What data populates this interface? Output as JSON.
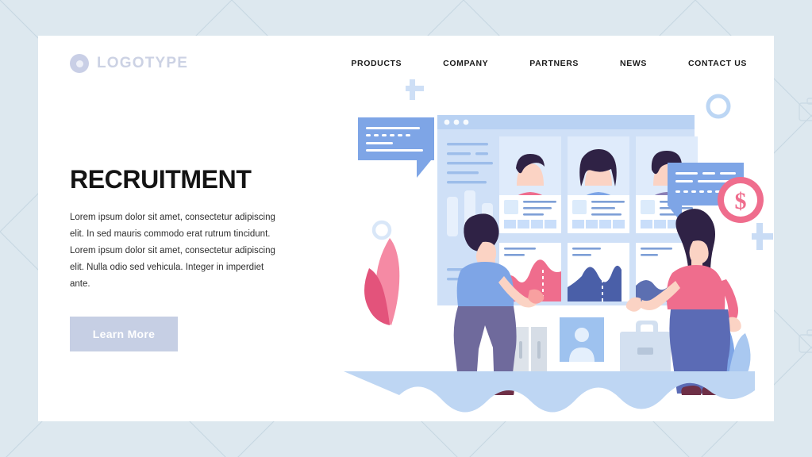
{
  "page": {
    "background_color": "#dde8ef",
    "card_color": "#ffffff"
  },
  "header": {
    "brand": {
      "label": "LOGOTYPE",
      "icon": "ring-logo-icon",
      "color": "#ccd2e4"
    },
    "nav": [
      {
        "label": "PRODUCTS"
      },
      {
        "label": "COMPANY"
      },
      {
        "label": "PARTNERS"
      },
      {
        "label": "NEWS"
      },
      {
        "label": "CONTACT US"
      }
    ]
  },
  "hero": {
    "title": "RECRUITMENT",
    "paragraph": "Lorem ipsum dolor sit amet, consectetur adipiscing elit. In sed mauris commodo erat rutrum tincidunt. Lorem ipsum dolor sit amet, consectetur adipiscing elit. Nulla  odio sed vehicula. Integer in imperdiet ante.",
    "cta_label": "Learn More",
    "cta_background": "#c6cfe4",
    "cta_text_color": "#ffffff"
  },
  "illustration": {
    "name": "recruitment-hero-illustration",
    "palette": {
      "blue_light": "#cfe0f7",
      "blue_mid": "#7ea5e6",
      "blue_deep": "#4a5fa8",
      "pink": "#ef6d8d",
      "pink_light": "#f8a8b8",
      "purple": "#8b7fb5",
      "skin": "#fbd3c4",
      "hair": "#2f2245",
      "pants": "#6f6a9c",
      "ground": "#bed6f3",
      "card_white": "#ffffff"
    },
    "elements": [
      {
        "name": "browser-window",
        "description": "dashboard window with candidate cards"
      },
      {
        "name": "candidate-card-1",
        "shirt_color": "#ef6d8d"
      },
      {
        "name": "candidate-card-2",
        "shirt_color": "#7ea5e6"
      },
      {
        "name": "candidate-card-3",
        "shirt_color": "#8b7fb5"
      },
      {
        "name": "area-chart-pink",
        "color": "#ef6d8d"
      },
      {
        "name": "area-chart-blue",
        "color": "#4a5fa8"
      },
      {
        "name": "speech-bubble-left",
        "color": "#7ea5e6"
      },
      {
        "name": "speech-bubble-right",
        "color": "#7ea5e6"
      },
      {
        "name": "dollar-badge",
        "color": "#ef6d8d",
        "symbol": "$"
      },
      {
        "name": "recruiter-man",
        "shirt_color": "#7ea5e6"
      },
      {
        "name": "recruiter-woman",
        "top_color": "#ef6d8d"
      },
      {
        "name": "briefcase-icon",
        "color": "#d2dff0"
      },
      {
        "name": "profile-card-icon",
        "color": "#9ec2ef"
      },
      {
        "name": "binders-icon",
        "color": "#d6dde6"
      },
      {
        "name": "leaf-pink",
        "color": "#ef6d8d"
      },
      {
        "name": "leaf-blue",
        "color": "#7ea5e6"
      },
      {
        "name": "plus-mark",
        "color": "#c3d9f2"
      },
      {
        "name": "circle-mark",
        "color": "#c3d9f2"
      }
    ]
  }
}
